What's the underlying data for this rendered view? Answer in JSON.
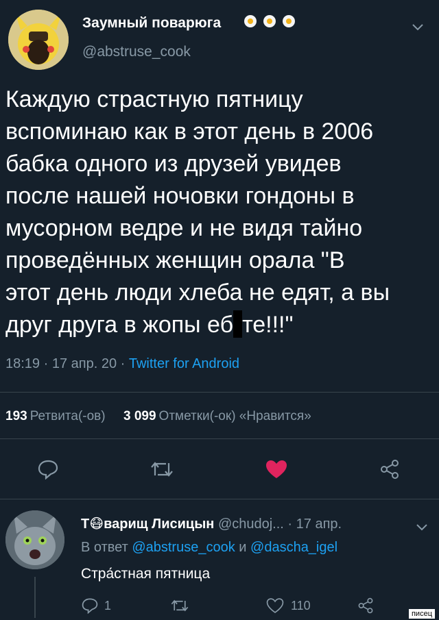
{
  "tweet": {
    "display_name": "Заумный поварюга",
    "handle": "@abstruse_cook",
    "text_before": "Каждую страстную пятницу\nвспоминаю как в этот день в 2006\nбабка одного из друзей увидев\nпосле нашей ночовки гондоны в\nмусорном ведре и не видя тайно\nпроведённых женщин орала \"В\nэтот день люди хлеба не едят, а вы\nдруг друга в жопы еб",
    "text_after": "те!!!\"",
    "time_date": "18:19 · 17 апр. 20 · ",
    "via": "Twitter for Android",
    "retweets_count": "193",
    "retweets_label": "Ретвита(-ов)",
    "likes_count": "3 099",
    "likes_label": "Отметки(-ок) «Нравится»"
  },
  "reply": {
    "display_name": "Т😷варищ Лисицын",
    "handle": "@chudoj...",
    "date": "· 17 апр.",
    "in_reply_prefix": "В ответ ",
    "mention_1": "@abstruse_cook",
    "conj": " и ",
    "mention_2": "@dascha_igel",
    "text": "Стра́стная пятница",
    "reply_count": "1",
    "like_count": "110"
  },
  "watermark": "писец",
  "colors": {
    "background": "#15202b",
    "secondary_text": "#8899a6",
    "link": "#1da1f2",
    "like_active": "#e0245e",
    "divider": "#38444d"
  }
}
